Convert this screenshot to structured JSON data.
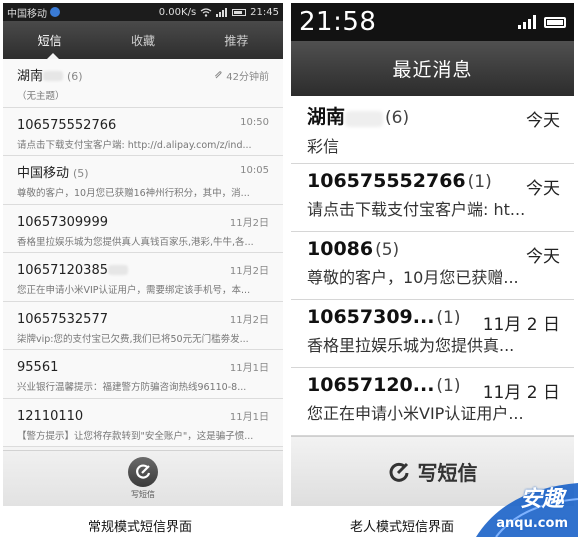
{
  "left": {
    "status": {
      "carrier": "中国移动",
      "speed": "0.00K/s",
      "time": "21:45"
    },
    "tabs": [
      {
        "label": "短信"
      },
      {
        "label": "收藏"
      },
      {
        "label": "推荐"
      }
    ],
    "messages": [
      {
        "sender": "湖南",
        "count": "(6)",
        "time": "42分钟前",
        "preview": "（无主题）"
      },
      {
        "sender": "106575552766",
        "count": "",
        "time": "10:50",
        "preview": "请点击下载支付宝客户端: http://d.alipay.com/z/ind..."
      },
      {
        "sender": "中国移动",
        "count": "(5)",
        "time": "10:05",
        "preview": "尊敬的客户，10月您已获赠16神州行积分，其中，消..."
      },
      {
        "sender": "10657309999",
        "count": "",
        "time": "11月2日",
        "preview": "香格里拉娱乐城为您提供真人真钱百家乐,港彩,牛牛,各..."
      },
      {
        "sender": "10657120385",
        "count": "",
        "time": "11月2日",
        "preview": "您正在申请小米VIP认证用户，需要绑定该手机号，本..."
      },
      {
        "sender": "10657532577",
        "count": "",
        "time": "11月2日",
        "preview": "柒牌vip:您的支付宝已欠费,我们已将50元无门槛劵发..."
      },
      {
        "sender": "95561",
        "count": "",
        "time": "11月1日",
        "preview": "兴业银行温馨提示：福建警方防骗咨询热线96110-8..."
      },
      {
        "sender": "12110110",
        "count": "",
        "time": "11月1日",
        "preview": "【警方提示】让您将存款转到\"安全账户\"，这是骗子惯..."
      }
    ],
    "compose_label": "写短信"
  },
  "right": {
    "status": {
      "time": "21:58"
    },
    "title": "最近消息",
    "messages": [
      {
        "sender": "湖南",
        "count": "(6)",
        "time": "今天",
        "preview": "彩信"
      },
      {
        "sender": "106575552766",
        "count": "(1)",
        "time": "今天",
        "preview": "请点击下载支付宝客户端: ht..."
      },
      {
        "sender": "10086",
        "count": "(5)",
        "time": "今天",
        "preview": "尊敬的客户，10月您已获赠..."
      },
      {
        "sender": "10657309...",
        "count": "(1)",
        "time": "11月 2 日",
        "preview": "香格里拉娱乐城为您提供真..."
      },
      {
        "sender": "10657120...",
        "count": "(1)",
        "time": "11月 2 日",
        "preview": "您正在申请小米VIP认证用户..."
      }
    ],
    "compose_label": "写短信"
  },
  "captions": {
    "left": "常规模式短信界面",
    "right": "老人模式短信界面"
  },
  "watermark": {
    "text": "安趣",
    "url": "anqu.com"
  },
  "colors": {
    "watermark_blue": "#1a62c8",
    "bar_dark": "#2e2e2e"
  }
}
